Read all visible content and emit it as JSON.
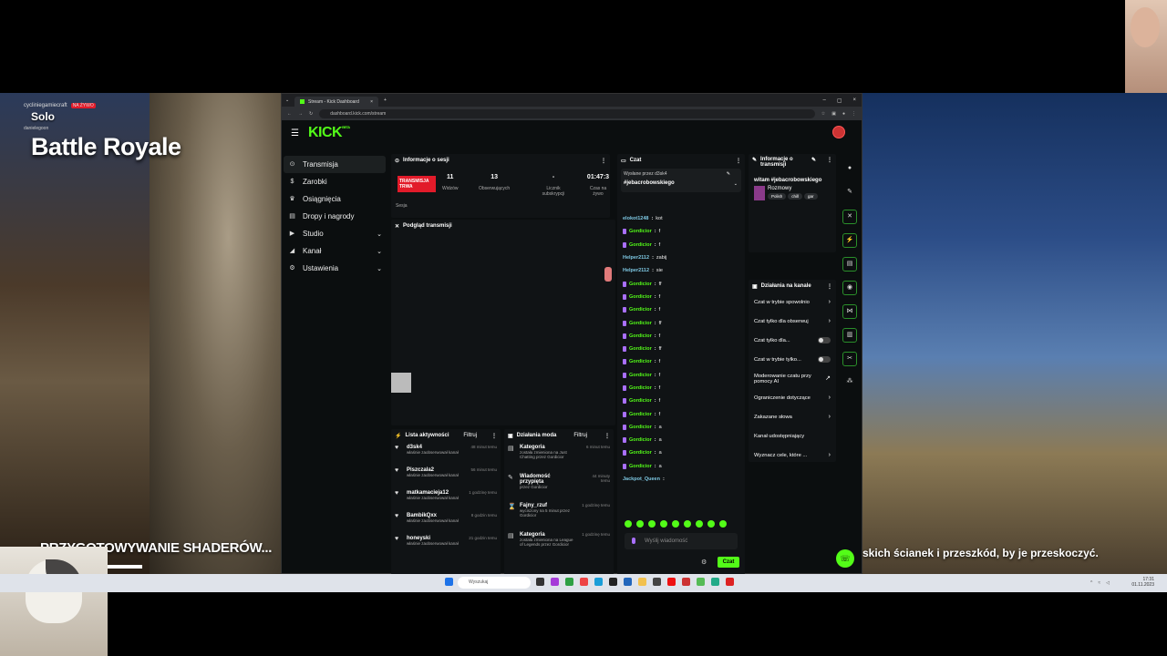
{
  "overlay": {
    "channel_user": "cycliniegamiecraft",
    "live_label": "NA ŻYWO",
    "second_user": "danielegoon",
    "mode": "Solo",
    "title": "Battle Royale",
    "shaders_text": "PRZYGOTOWYWANIE SHADERÓW...",
    "subtitle": "skich ścianek i przeszkód, by je przeskoczyć."
  },
  "browser": {
    "tab_title": "Stream - Kick Dashboard",
    "url": "dashboard.kick.com/stream"
  },
  "kick": {
    "logo": "KICK",
    "beta": "BETA"
  },
  "sidebar": {
    "items": [
      {
        "label": "Transmisja",
        "icon": "broadcast-icon"
      },
      {
        "label": "Zarobki",
        "icon": "dollar-icon"
      },
      {
        "label": "Osiągnięcia",
        "icon": "trophy-icon"
      },
      {
        "label": "Dropy i nagrody",
        "icon": "gift-icon"
      },
      {
        "label": "Studio",
        "icon": "studio-icon"
      },
      {
        "label": "Kanał",
        "icon": "channel-icon"
      },
      {
        "label": "Ustawienia",
        "icon": "gear-icon"
      }
    ]
  },
  "session": {
    "title": "Informacje o sesji",
    "live_badge": "TRANSMISJA TRWA",
    "viewers_value": "11",
    "viewers_label": "Widzów",
    "followers_value": "13",
    "followers_label": "Obserwujących",
    "subs_value": "-",
    "subs_label": "Licznik subskrypcji",
    "time_value": "01:47:3",
    "time_label": "Czas na żywo",
    "session_label": "Sesja"
  },
  "preview": {
    "title": "Podgląd transmisji"
  },
  "activity": {
    "title": "Lista aktywności",
    "filter": "Filtruj",
    "rows": [
      {
        "user": "d3sk4",
        "action": "właśnie zaobserwował kanał",
        "time": "48 minut temu"
      },
      {
        "user": "Piszczala2",
        "action": "właśnie zaobserwował kanał",
        "time": "56 minut temu"
      },
      {
        "user": "matkamaciejа12",
        "action": "właśnie zaobserwował kanał",
        "time": "1 godzinę temu"
      },
      {
        "user": "BambikQxx",
        "action": "właśnie zaobserwował kanał",
        "time": "8 godzin temu"
      },
      {
        "user": "honeyski",
        "action": "właśnie zaobserwował kanał",
        "time": "21 godzin temu"
      }
    ]
  },
  "modactions": {
    "title": "Działania moda",
    "filter": "Filtruj",
    "rows": [
      {
        "title": "Kategoria",
        "detail": "została zmieniona na Just Chatting przez Gordicior",
        "time": "6 minut temu"
      },
      {
        "title": "Wiadomość przypięta",
        "detail": "przez Gordicior",
        "time": "44 minuty temu"
      },
      {
        "title": "Fajny_rzuf",
        "detail": "wyciszony na 5 minut przez Gordicior",
        "time": "1 godzinę temu"
      },
      {
        "title": "Kategoria",
        "detail": "została zmieniona na League of Legends przez Gordicior",
        "time": "1 godzinę temu"
      }
    ]
  },
  "chat": {
    "title": "Czat",
    "pinned_by": "Wysłane przez d3sk4",
    "pinned_msg": "#jebacrobowskiego",
    "messages": [
      {
        "user": "elokot1248",
        "text": "kot",
        "badge": false
      },
      {
        "user": "Gordicior",
        "text": "f",
        "badge": true
      },
      {
        "user": "Gordicior",
        "text": "f",
        "badge": true
      },
      {
        "user": "Helper2112",
        "text": "zabij",
        "badge": false
      },
      {
        "user": "Helper2112",
        "text": "sie",
        "badge": false
      },
      {
        "user": "Gordicior",
        "text": "ff",
        "badge": true
      },
      {
        "user": "Gordicior",
        "text": "f",
        "badge": true
      },
      {
        "user": "Gordicior",
        "text": "f",
        "badge": true
      },
      {
        "user": "Gordicior",
        "text": "ff",
        "badge": true
      },
      {
        "user": "Gordicior",
        "text": "f",
        "badge": true
      },
      {
        "user": "Gordicior",
        "text": "ff",
        "badge": true
      },
      {
        "user": "Gordicior",
        "text": "f",
        "badge": true
      },
      {
        "user": "Gordicior",
        "text": "f",
        "badge": true
      },
      {
        "user": "Gordicior",
        "text": "f",
        "badge": true
      },
      {
        "user": "Gordicior",
        "text": "f",
        "badge": true
      },
      {
        "user": "Gordicior",
        "text": "f",
        "badge": true
      },
      {
        "user": "Gordicior",
        "text": "a",
        "badge": true
      },
      {
        "user": "Gordicior",
        "text": "a",
        "badge": true
      },
      {
        "user": "Gordicior",
        "text": "a",
        "badge": true
      },
      {
        "user": "Gordicior",
        "text": "a",
        "badge": true
      },
      {
        "user": "Jackpot_Queen",
        "text": "",
        "badge": false
      }
    ],
    "input_placeholder": "Wyślij wiadomość",
    "send_label": "Czat"
  },
  "stream_info": {
    "title": "Informacje o transmisji",
    "stream_title": "witam #jebacrobowskiego",
    "category": "Rozmowy",
    "tags": [
      "Polish",
      "chill",
      "gar"
    ]
  },
  "channel_actions": {
    "title": "Działania na kanale",
    "rows": [
      {
        "label": "Czat w trybie spowolnio",
        "kind": "chevron"
      },
      {
        "label": "Czat tylko dla obserwuj",
        "kind": "chevron"
      },
      {
        "label": "Czat tylko dla...",
        "kind": "toggle"
      },
      {
        "label": "Czat w trybie tylko...",
        "kind": "toggle"
      },
      {
        "label": "Moderowanie czatu przy pomocy AI",
        "kind": "ext"
      },
      {
        "label": "Ograniczenie dotyczące",
        "kind": "chevron"
      },
      {
        "label": "Zakazane słowa",
        "kind": "chevron"
      },
      {
        "label": "Kanał udostępniający",
        "kind": "none"
      },
      {
        "label": "Wyznacz cele, które ...",
        "kind": "chevron"
      }
    ]
  },
  "taskbar": {
    "search": "Wyszukaj",
    "time": "17:31",
    "date": "01.11.2023"
  }
}
